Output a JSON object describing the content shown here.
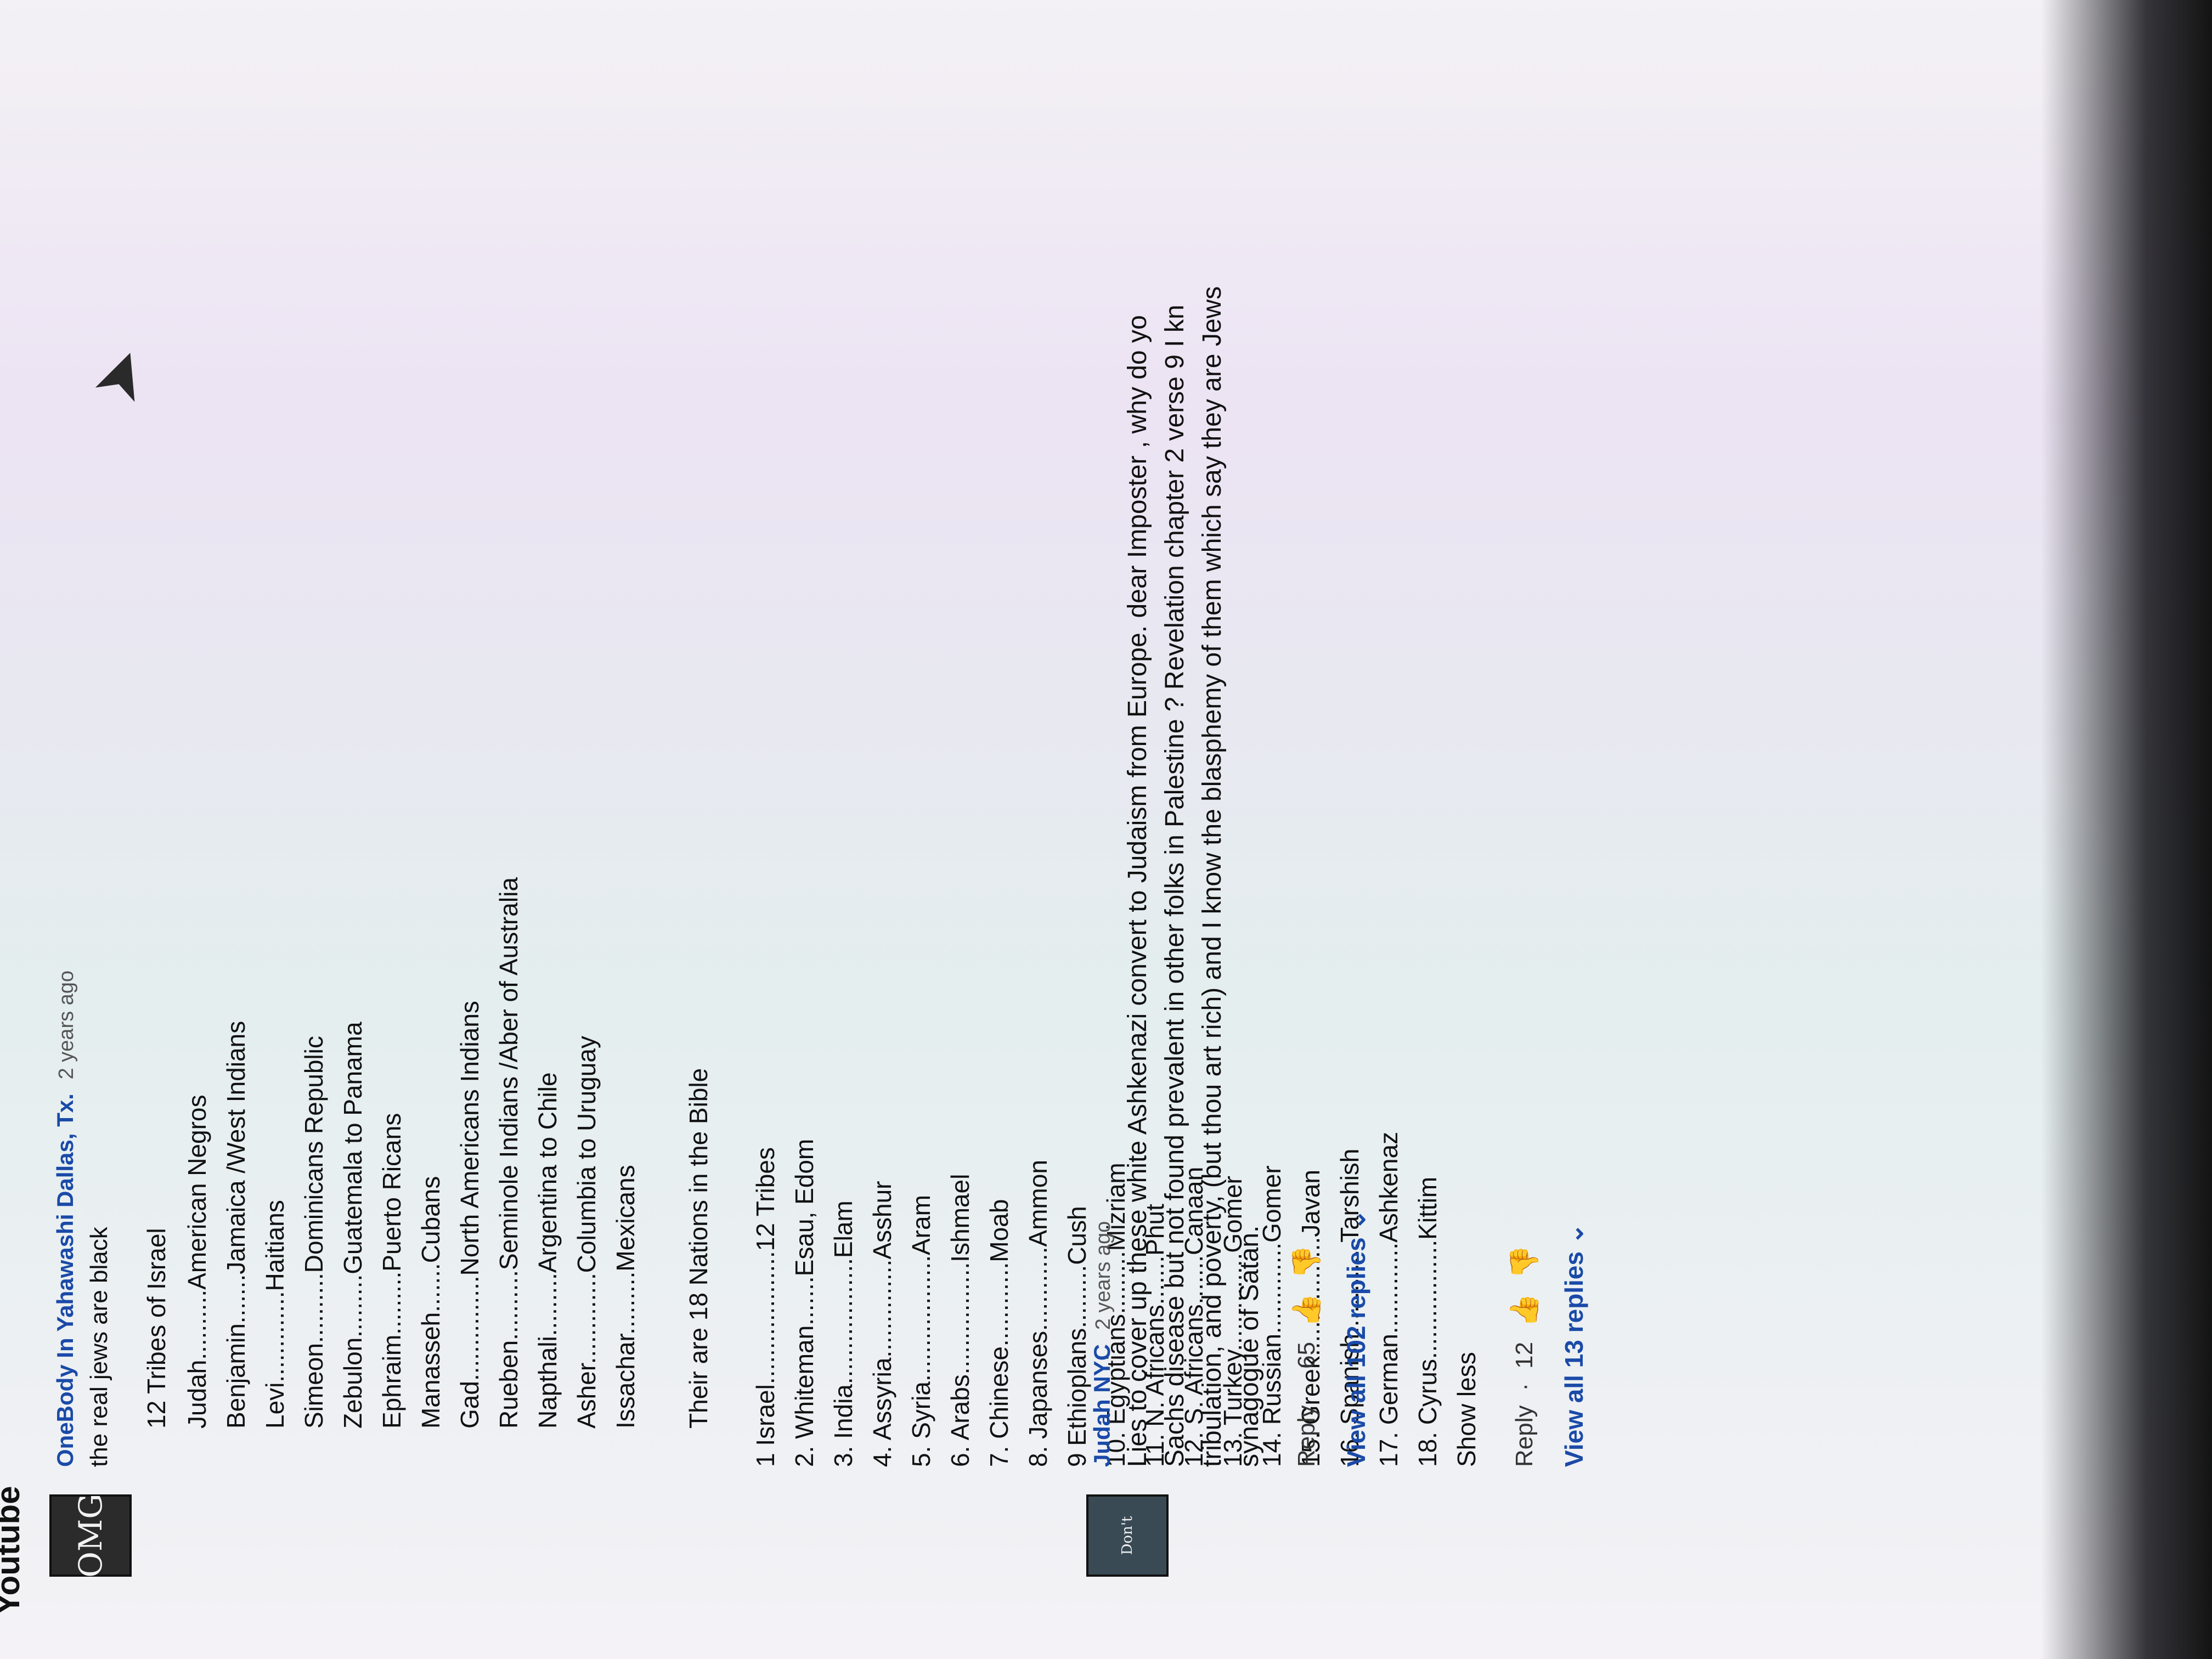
{
  "header_fragment": "Youtube",
  "comment1": {
    "avatar_text": "OMG",
    "author": "OneBody In Yahawashi Dallas, Tx.",
    "time": "2 years ago",
    "intro": "the real jews are black",
    "tribes_title": "12 Tribes of Israel",
    "tribes": [
      "Judah..........American Negros",
      "Benjamin.......Jamaica /West Indians",
      "Levi.............Haitians",
      "Simeon..........Dominicans Republic",
      "Zebulon.........Guatemala to Panama",
      "Ephraim.........Puerto Ricans",
      "Manasseh.......Cubans",
      "Gad...............North Americans Indians",
      "Rueben..........Seminole Indians /Aber of Australia",
      "Napthali.........Argentina to Chile",
      "Asher.............Columbia to Uruguay",
      "Issachar.........Mexicans"
    ],
    "nations_title": "Their are 18 Nations in the Bible",
    "nations": [
      "1 Israel...................12 Tribes",
      "2. Whiteman.......Esau, Edom",
      "3. India..................Elam",
      "4. Assyria..............Asshur",
      "5. Syria..................Aram",
      "6. Arabs................Ishmael",
      "7. Chinese............Moab",
      "8. Japanses............Ammon",
      "9 Ethioplans.........Cush",
      "10. Egyptians.........Mizriam",
      "11. N. Africans.......Phut",
      "12. S. Africans.......Canaan",
      "13. Turkey..............Gomer",
      "14. Russian.............Gomer",
      "15. Greek.................Javan",
      "16. Spanish.............Tarshish",
      "17. German.............Ashkenaz",
      "18. Cyrus.................Kittim"
    ],
    "show_less": "Show less",
    "reply_label": "Reply",
    "likes": "12",
    "view_replies": "View all 13 replies"
  },
  "comment2": {
    "avatar_text": "Don't",
    "author": "Judah NYC",
    "time": "2 years ago",
    "lines": [
      "Lies to cover up these white Ashkenazi convert to Judaism from Europe.  dear Imposter , why do yo",
      "Sachs disease but not found  prevalent in other folks in Palestine ?  Revelation chapter 2 verse  9 I kn",
      "tribulation, and poverty, (but thou art rich) and I know the blasphemy of them which say they are Jews",
      "synagogue of Satan."
    ],
    "reply_label": "Reply",
    "likes": "65",
    "view_replies": "View all 102 replies"
  }
}
